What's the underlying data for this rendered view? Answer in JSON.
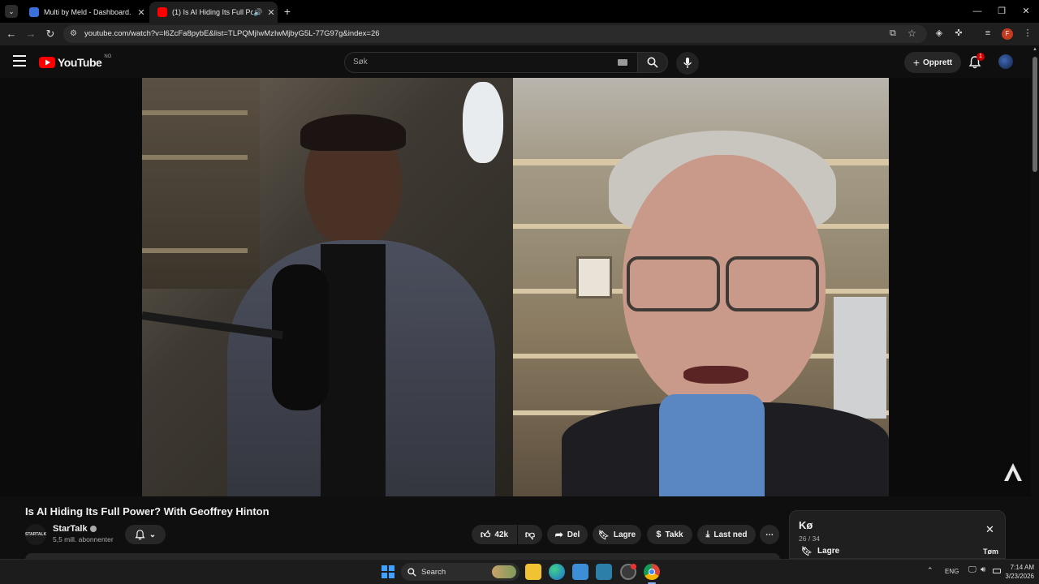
{
  "browser": {
    "tabs": [
      {
        "title": "Multi by Meld - Dashboard.",
        "active": false
      },
      {
        "title": "(1) Is AI Hiding Its Full Powe",
        "active": true
      }
    ],
    "url": "youtube.com/watch?v=l6ZcFa8pybE&list=TLPQMjIwMzIwMjbyG5L-77G97g&index=26",
    "profile_initial": "F"
  },
  "youtube": {
    "logo_text": "YouTube",
    "region": "NO",
    "search_placeholder": "Søk",
    "create_label": "Opprett",
    "notification_count": "1"
  },
  "video": {
    "title": "Is AI Hiding Its Full Power? With Geoffrey Hinton",
    "channel_name": "StarTalk",
    "channel_avatar_text": "STARTALK",
    "subscribers": "5,5 mill. abonnenter",
    "likes": "42k",
    "share_label": "Del",
    "save_label": "Lagre",
    "thanks_label": "Takk",
    "download_label": "Last ned"
  },
  "queue": {
    "title": "Kø",
    "position": "26 / 34",
    "save_label": "Lagre",
    "clear_label": "Tøm"
  },
  "taskbar": {
    "search_label": "Search",
    "language": "ENG",
    "time": "7:14 AM",
    "date": "3/23/2026"
  },
  "colors": {
    "youtube_red": "#ff0000",
    "accent_profile": "#c43a1f"
  }
}
